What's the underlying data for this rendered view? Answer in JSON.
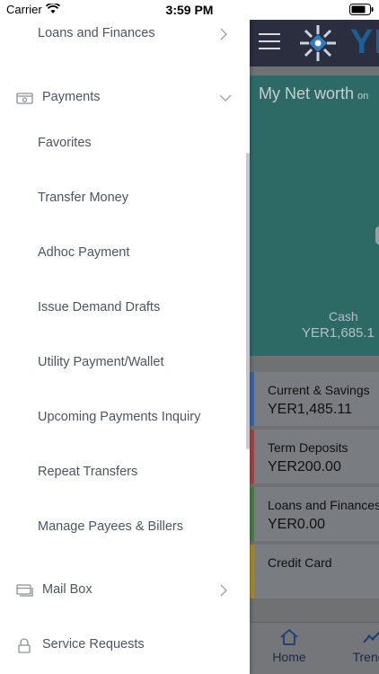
{
  "status_bar": {
    "carrier": "Carrier",
    "time": "3:59 PM"
  },
  "app": {
    "brand": "YK",
    "networth": {
      "title": "My Net worth",
      "suffix": "on",
      "cash_label": "Cash",
      "cash_value": "YER1,685.1"
    },
    "accounts": [
      {
        "label": "Current & Savings",
        "value": "YER1,485.11",
        "color": "#3d67a2"
      },
      {
        "label": "Term Deposits",
        "value": "YER200.00",
        "color": "#9c4848"
      },
      {
        "label": "Loans and Finances",
        "value": "YER0.00",
        "color": "#4f7d4c"
      },
      {
        "label": "Credit Card",
        "value": "",
        "color": "#a78a34"
      }
    ],
    "tabs": [
      {
        "label": "Home",
        "icon": "home-icon"
      },
      {
        "label": "Trends",
        "icon": "trend-icon"
      }
    ]
  },
  "drawer": {
    "loans_item": "Loans and Finances",
    "payments": {
      "label": "Payments",
      "icon": "payments-icon",
      "items": [
        "Favorites",
        "Transfer Money",
        "Adhoc Payment",
        "Issue Demand Drafts",
        "Utility Payment/Wallet",
        "Upcoming Payments Inquiry",
        "Repeat Transfers",
        "Manage Payees & Billers"
      ]
    },
    "mailbox": {
      "label": "Mail Box",
      "icon": "mailbox-icon"
    },
    "service_requests": {
      "label": "Service Requests",
      "icon": "lock-icon"
    }
  },
  "colors": {
    "drawer_text": "#4b5563",
    "header": "#2b2e3f",
    "networth": "#2d6a66",
    "accent": "#1d5f94"
  }
}
